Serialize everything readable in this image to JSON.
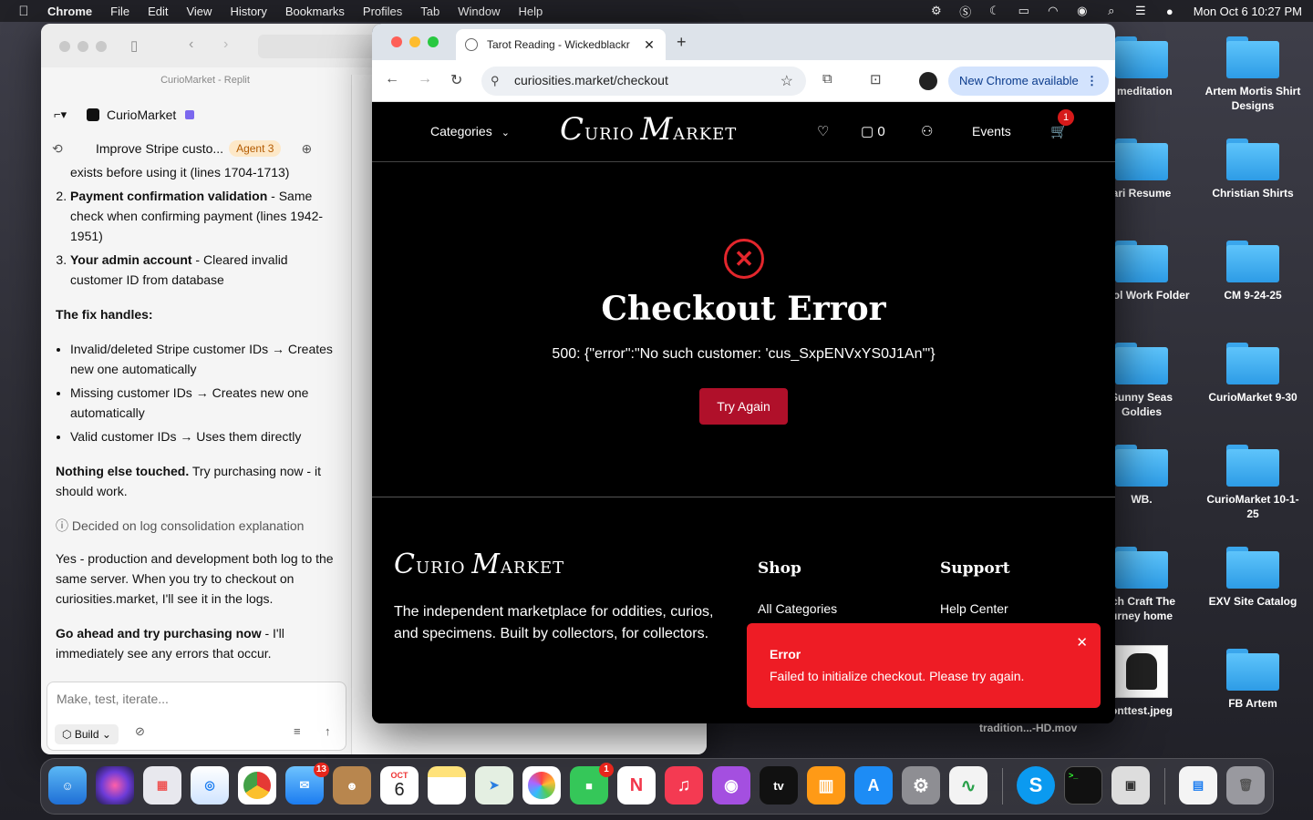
{
  "menubar": {
    "app": "Chrome",
    "items": [
      "File",
      "Edit",
      "View",
      "History",
      "Bookmarks",
      "Profiles",
      "Tab",
      "Window",
      "Help"
    ],
    "clock": "Mon Oct 6  10:27 PM"
  },
  "desktop": {
    "icons": [
      {
        "label": "i meditation"
      },
      {
        "label": "Artem Mortis Shirt Designs"
      },
      {
        "label": "ari Resume"
      },
      {
        "label": "Christian Shirts"
      },
      {
        "label": "arisol Work Folder"
      },
      {
        "label": "CM 9-24-25"
      },
      {
        "label": "Sunny Seas Goldies"
      },
      {
        "label": "CurioMarket 9-30"
      },
      {
        "label": "WB."
      },
      {
        "label": "CurioMarket 10-1-25"
      },
      {
        "label": "tch Craft The urney home"
      },
      {
        "label": "EXV Site Catalog"
      },
      {
        "label": "onttest.jpeg"
      },
      {
        "label": "FB Artem"
      }
    ],
    "file_label": "tradition...-HD.mov"
  },
  "replit": {
    "window_title": "CurioMarket - Replit",
    "project_name": "CurioMarket",
    "task_title": "Improve Stripe custo...",
    "agent_badge": "Agent 3",
    "chat": {
      "line0": "exists before using it (lines 1704-1713)",
      "item2_bold": "Payment confirmation validation",
      "item2_text": " - Same check when confirming payment (lines 1942-1951)",
      "item3_bold": "Your admin account",
      "item3_text": " - Cleared invalid customer ID from database",
      "handles_heading": "The fix handles:",
      "bullet1": "Invalid/deleted Stripe customer IDs → Creates new one automatically",
      "bullet2": "Missing customer IDs → Creates new one automatically",
      "bullet3": "Valid customer IDs → Uses them directly",
      "nothing_bold": "Nothing else touched.",
      "nothing_text": " Try purchasing now - it should work.",
      "thinking": "Decided on log consolidation explanation",
      "para_logs": "Yes - production and development both log to the same server. When you try to checkout on curiosities.market, I'll see it in the logs.",
      "goahead_bold": "Go ahead and try purchasing now",
      "goahead_text": " - I'll immediately see any errors that occur."
    },
    "composer": {
      "placeholder": "Make, test, iterate...",
      "mode": "Build"
    }
  },
  "chrome": {
    "tab_title": "Tarot Reading - Wickedblackr",
    "url": "curiosities.market/checkout",
    "update_label": "New Chrome available"
  },
  "site": {
    "nav": {
      "categories": "Categories",
      "brand_c": "C",
      "brand_urio": "URIO ",
      "brand_m": "M",
      "brand_arket": "ARKET",
      "message_count": "0",
      "events": "Events",
      "cart_count": "1"
    },
    "error": {
      "title": "Checkout Error",
      "message": "500: {\"error\":\"No such customer: 'cus_SxpENVxYS0J1An'\"}",
      "button": "Try Again"
    },
    "footer": {
      "tagline": "The independent marketplace for oddities, curios, and specimens. Built by collectors, for collectors.",
      "shop_heading": "Shop",
      "shop_item": "All Categories",
      "support_heading": "Support",
      "support_item": "Help Center"
    },
    "toast": {
      "title": "Error",
      "message": "Failed to initialize checkout. Please try again."
    }
  },
  "dock": {
    "mail_badge": "13",
    "calendar_month": "OCT",
    "calendar_day": "6",
    "facetime_badge": "1",
    "tv_label": "tv"
  },
  "colors": {
    "accent_red": "#ee1c25",
    "button_red": "#b0102a",
    "folder_blue": "#2d9ce6"
  }
}
